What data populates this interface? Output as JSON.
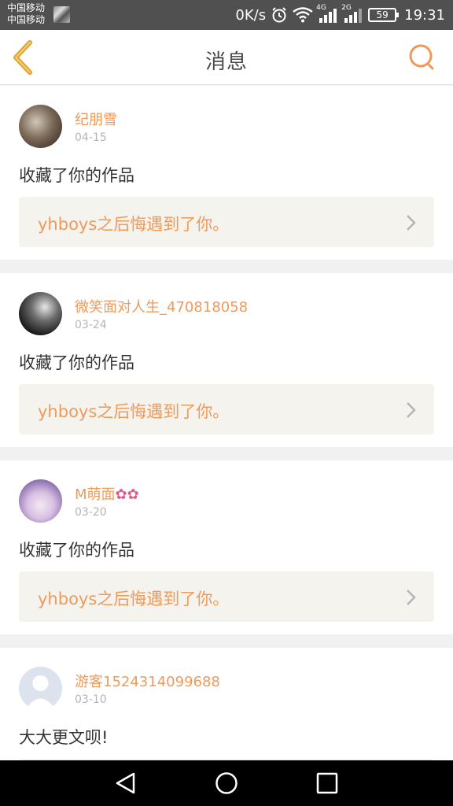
{
  "status_bar": {
    "carrier_1": "中国移动",
    "carrier_2": "中国移动",
    "speed": "0K/s",
    "network_4g": "4G",
    "network_2g": "2G",
    "battery": "59",
    "time": "19:31"
  },
  "nav": {
    "title": "消息",
    "back_icon": "chevron-left-icon",
    "search_icon": "search-icon",
    "accent": "#f09a5a"
  },
  "messages": [
    {
      "user": "纪朋雪",
      "date": "04-15",
      "action": "收藏了你的作品",
      "work": "yhboys之后悔遇到了你。"
    },
    {
      "user": "微笑面对人生_470818058",
      "date": "03-24",
      "action": "收藏了你的作品",
      "work": "yhboys之后悔遇到了你。"
    },
    {
      "user": "M萌面",
      "user_suffix": "✿✿",
      "date": "03-20",
      "action": "收藏了你的作品",
      "work": "yhboys之后悔遇到了你。"
    },
    {
      "user": "游客1524314099688",
      "date": "03-10",
      "action": "大大更文呗!",
      "work": ""
    }
  ],
  "system_nav": {
    "back": "back-triangle-icon",
    "home": "home-circle-icon",
    "recent": "recent-square-icon"
  }
}
